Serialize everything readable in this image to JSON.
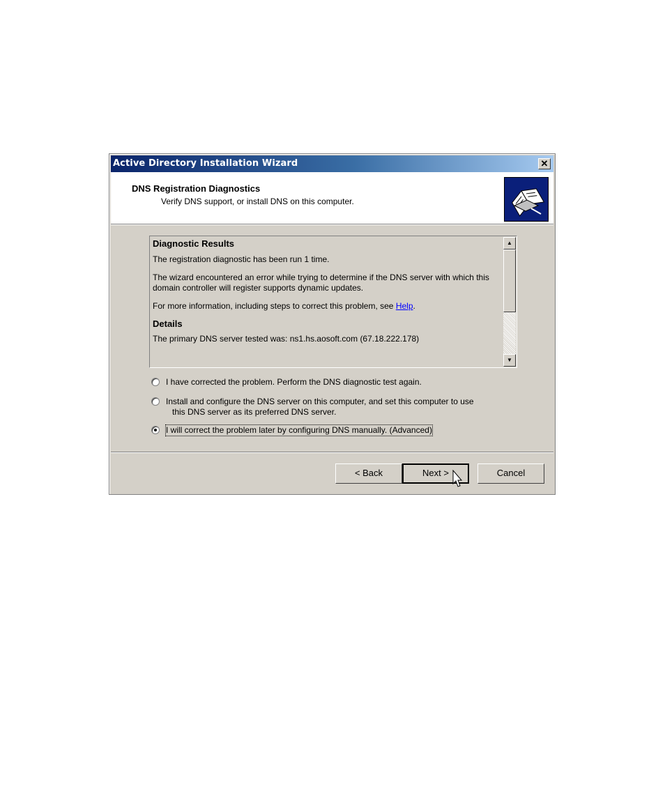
{
  "window": {
    "title": "Active Directory Installation Wizard",
    "close_label": "✕"
  },
  "header": {
    "title": "DNS Registration Diagnostics",
    "subtitle": "Verify DNS support, or install DNS on this computer."
  },
  "results": {
    "heading": "Diagnostic Results",
    "run_text": "The registration diagnostic has been run 1 time.",
    "error_text": "The wizard encountered an error while trying to determine if the DNS server with which this domain controller will register supports dynamic updates.",
    "info_prefix": "For more information, including steps to correct this problem, see ",
    "help_link": "Help",
    "info_suffix": ".",
    "details_heading": "Details",
    "details_text": "The primary DNS server tested was: ns1.hs.aosoft.com (67.18.222.178)"
  },
  "options": [
    {
      "label_line1": "I have corrected the problem. Perform the DNS diagnostic test again.",
      "label_line2": "",
      "checked": false
    },
    {
      "label_line1": "Install and configure the DNS server on this computer, and set this computer to use",
      "label_line2": "this DNS server as its preferred DNS server.",
      "checked": false
    },
    {
      "label_line1": "I will correct the problem later by configuring DNS manually. (Advanced)",
      "label_line2": "",
      "checked": true
    }
  ],
  "buttons": {
    "back": "< Back",
    "next": "Next >",
    "cancel": "Cancel"
  },
  "colors": {
    "title_gradient_start": "#0a246a",
    "title_gradient_end": "#a6caf0",
    "dialog_bg": "#d4d0c8",
    "link": "#0000ff"
  }
}
